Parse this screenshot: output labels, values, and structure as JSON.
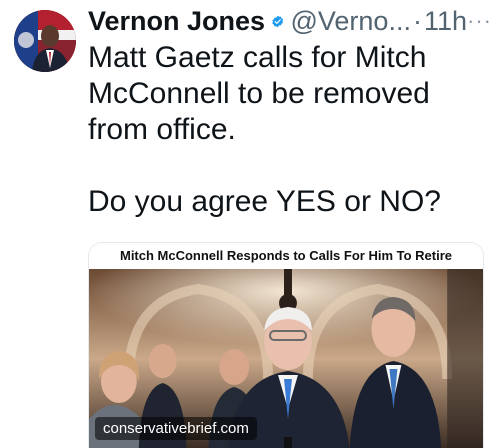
{
  "tweet": {
    "author_name": "Vernon Jones",
    "handle": "@Verno...",
    "separator": "·",
    "time": "11h",
    "more_label": "···",
    "text": "Matt Gaetz calls for Mitch McConnell to be removed from office.\n\nDo you agree YES or NO?",
    "verified_color": "#1d9bf0",
    "verified_icon": "check-badge-icon",
    "more_icon": "more-dots-icon"
  },
  "card": {
    "headline": "Mitch McConnell Responds to Calls For Him To Retire",
    "source": "conservativebrief.com",
    "photo_icon": "press-photo-image"
  }
}
